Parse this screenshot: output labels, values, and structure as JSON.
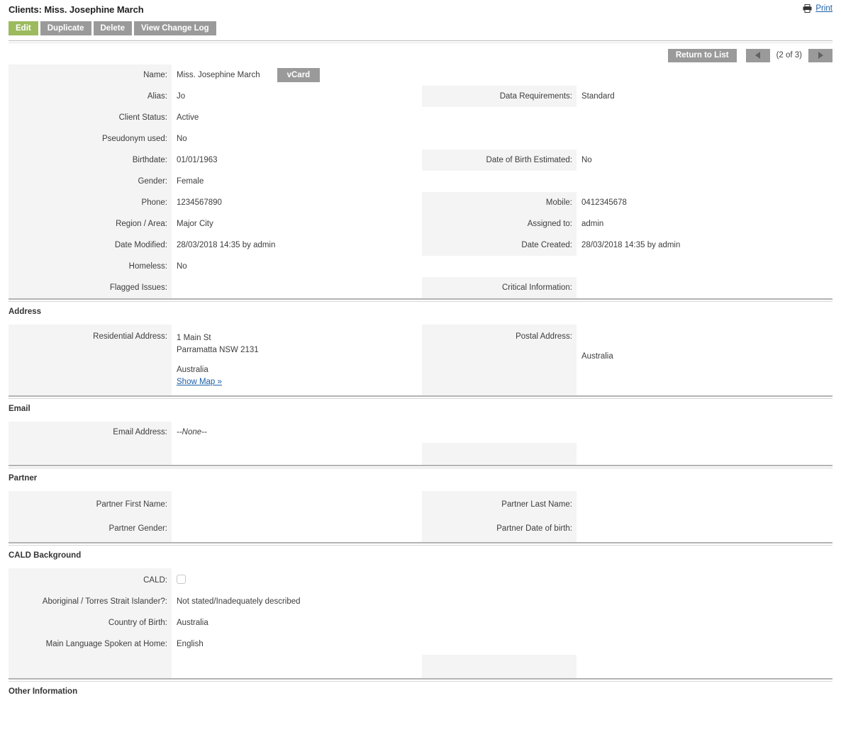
{
  "header": {
    "title": "Clients: Miss. Josephine March",
    "print_label": "Print",
    "print_icon": "printer-icon"
  },
  "actions": [
    {
      "label": "Edit",
      "primary": true
    },
    {
      "label": "Duplicate",
      "primary": false
    },
    {
      "label": "Delete",
      "primary": false
    },
    {
      "label": "View Change Log",
      "primary": false
    }
  ],
  "nav": {
    "return_label": "Return to List",
    "prev_icon": "arrow-left-icon",
    "next_icon": "arrow-right-icon",
    "count": "(2 of 3)"
  },
  "fields": {
    "name_label": "Name:",
    "name_value": "Miss. Josephine March",
    "vcard_label": "vCard",
    "data_requirements_label": "Data Requirements:",
    "data_requirements_value": "Standard",
    "alias_label": "Alias:",
    "alias_value": "Jo",
    "client_status_label": "Client Status:",
    "client_status_value": "Active",
    "pseudonym_label": "Pseudonym used:",
    "pseudonym_value": "No",
    "birthdate_label": "Birthdate:",
    "birthdate_value": "01/01/1963",
    "dob_estimated_label": "Date of Birth Estimated:",
    "dob_estimated_value": "No",
    "gender_label": "Gender:",
    "gender_value": "Female",
    "phone_label": "Phone:",
    "phone_value": "1234567890",
    "mobile_label": "Mobile:",
    "mobile_value": "0412345678",
    "region_label": "Region / Area:",
    "region_value": "Major City",
    "assigned_to_label": "Assigned to:",
    "assigned_to_value": "admin",
    "date_modified_label": "Date Modified:",
    "date_modified_value": "28/03/2018 14:35 by admin",
    "date_created_label": "Date Created:",
    "date_created_value": "28/03/2018 14:35 by admin",
    "homeless_label": "Homeless:",
    "homeless_value": "No",
    "flagged_issues_label": "Flagged Issues:",
    "flagged_issues_value": "",
    "critical_information_label": "Critical Information:",
    "critical_information_value": ""
  },
  "address": {
    "section_title": "Address",
    "residential_label": "Residential Address:",
    "residential_line1": "1 Main St",
    "residential_line2": "Parramatta NSW 2131",
    "residential_country": "Australia",
    "show_map_label": "Show Map »",
    "postal_label": "Postal Address:",
    "postal_country": "Australia"
  },
  "email": {
    "section_title": "Email",
    "email_label": "Email Address:",
    "email_value": "--None--"
  },
  "partner": {
    "section_title": "Partner",
    "first_name_label": "Partner First Name:",
    "first_name_value": "",
    "last_name_label": "Partner Last Name:",
    "last_name_value": "",
    "gender_label": "Partner Gender:",
    "gender_value": "",
    "dob_label": "Partner Date of birth:",
    "dob_value": ""
  },
  "cald": {
    "section_title": "CALD Background",
    "cald_label": "CALD:",
    "cald_checked": false,
    "atsi_label": "Aboriginal / Torres Strait Islander?:",
    "atsi_value": "Not stated/Inadequately described",
    "country_of_birth_label": "Country of Birth:",
    "country_of_birth_value": "Australia",
    "language_label": "Main Language Spoken at Home:",
    "language_value": "English"
  },
  "other": {
    "section_title": "Other Information"
  },
  "colors": {
    "primary_button": "#9cba5e",
    "button": "#9a9a9a",
    "label_bg": "#f4f4f4",
    "link": "#1b5faa"
  }
}
